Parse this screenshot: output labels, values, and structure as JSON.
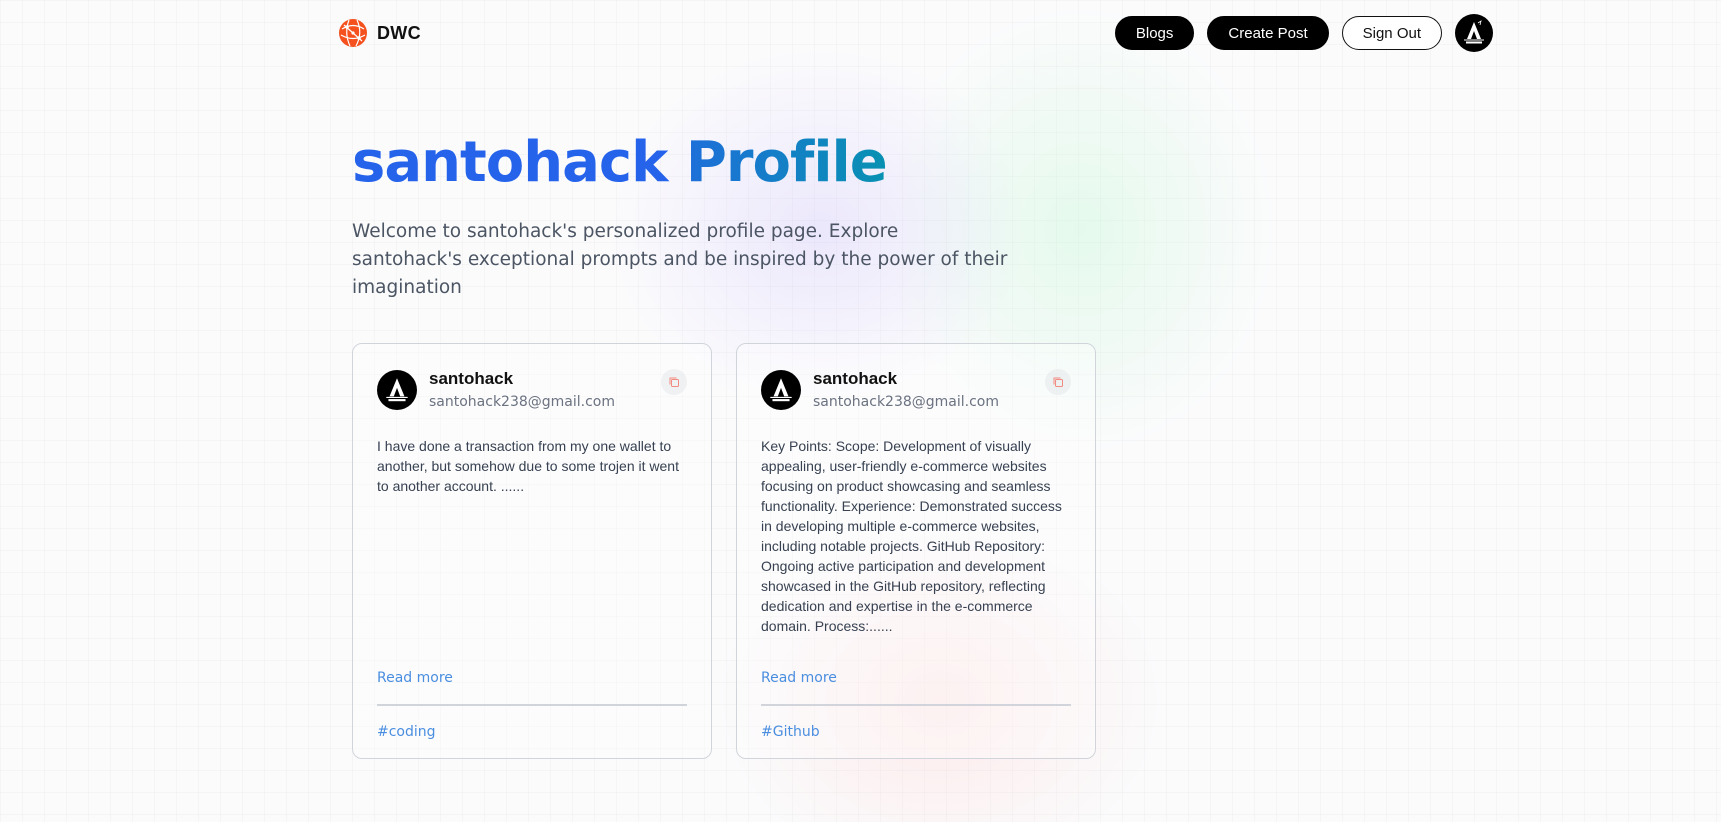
{
  "nav": {
    "brand": "DWC",
    "blogs_label": "Blogs",
    "create_label": "Create Post",
    "signout_label": "Sign Out"
  },
  "hero": {
    "username": "santohack",
    "profile_word": "Profile",
    "description": "Welcome to santohack's personalized profile page. Explore santohack's exceptional prompts and be inspired by the power of their imagination"
  },
  "cards": [
    {
      "username": "santohack",
      "email": "santohack238@gmail.com",
      "body": "I have done a transaction from my one wallet to another, but somehow due to some trojen it went to another account. ......",
      "read_more": "Read more",
      "tag": "#coding"
    },
    {
      "username": "santohack",
      "email": "santohack238@gmail.com",
      "body": "Key Points: Scope: Development of visually appealing, user-friendly e-commerce websites focusing on product showcasing and seamless functionality. Experience: Demonstrated success in developing multiple e-commerce websites, including notable projects. GitHub Repository: Ongoing active participation and development showcased in the GitHub repository, reflecting dedication and expertise in the e-commerce domain. Process:......",
      "read_more": "Read more",
      "tag": "#Github"
    }
  ],
  "colors": {
    "accent_blue": "#2563eb",
    "link_blue": "#4a8ee0",
    "logo_orange": "#f97316"
  },
  "icons": {
    "logo": "globe-logo-icon",
    "copy": "copy-icon",
    "avatar": "hacker-avatar-icon"
  }
}
